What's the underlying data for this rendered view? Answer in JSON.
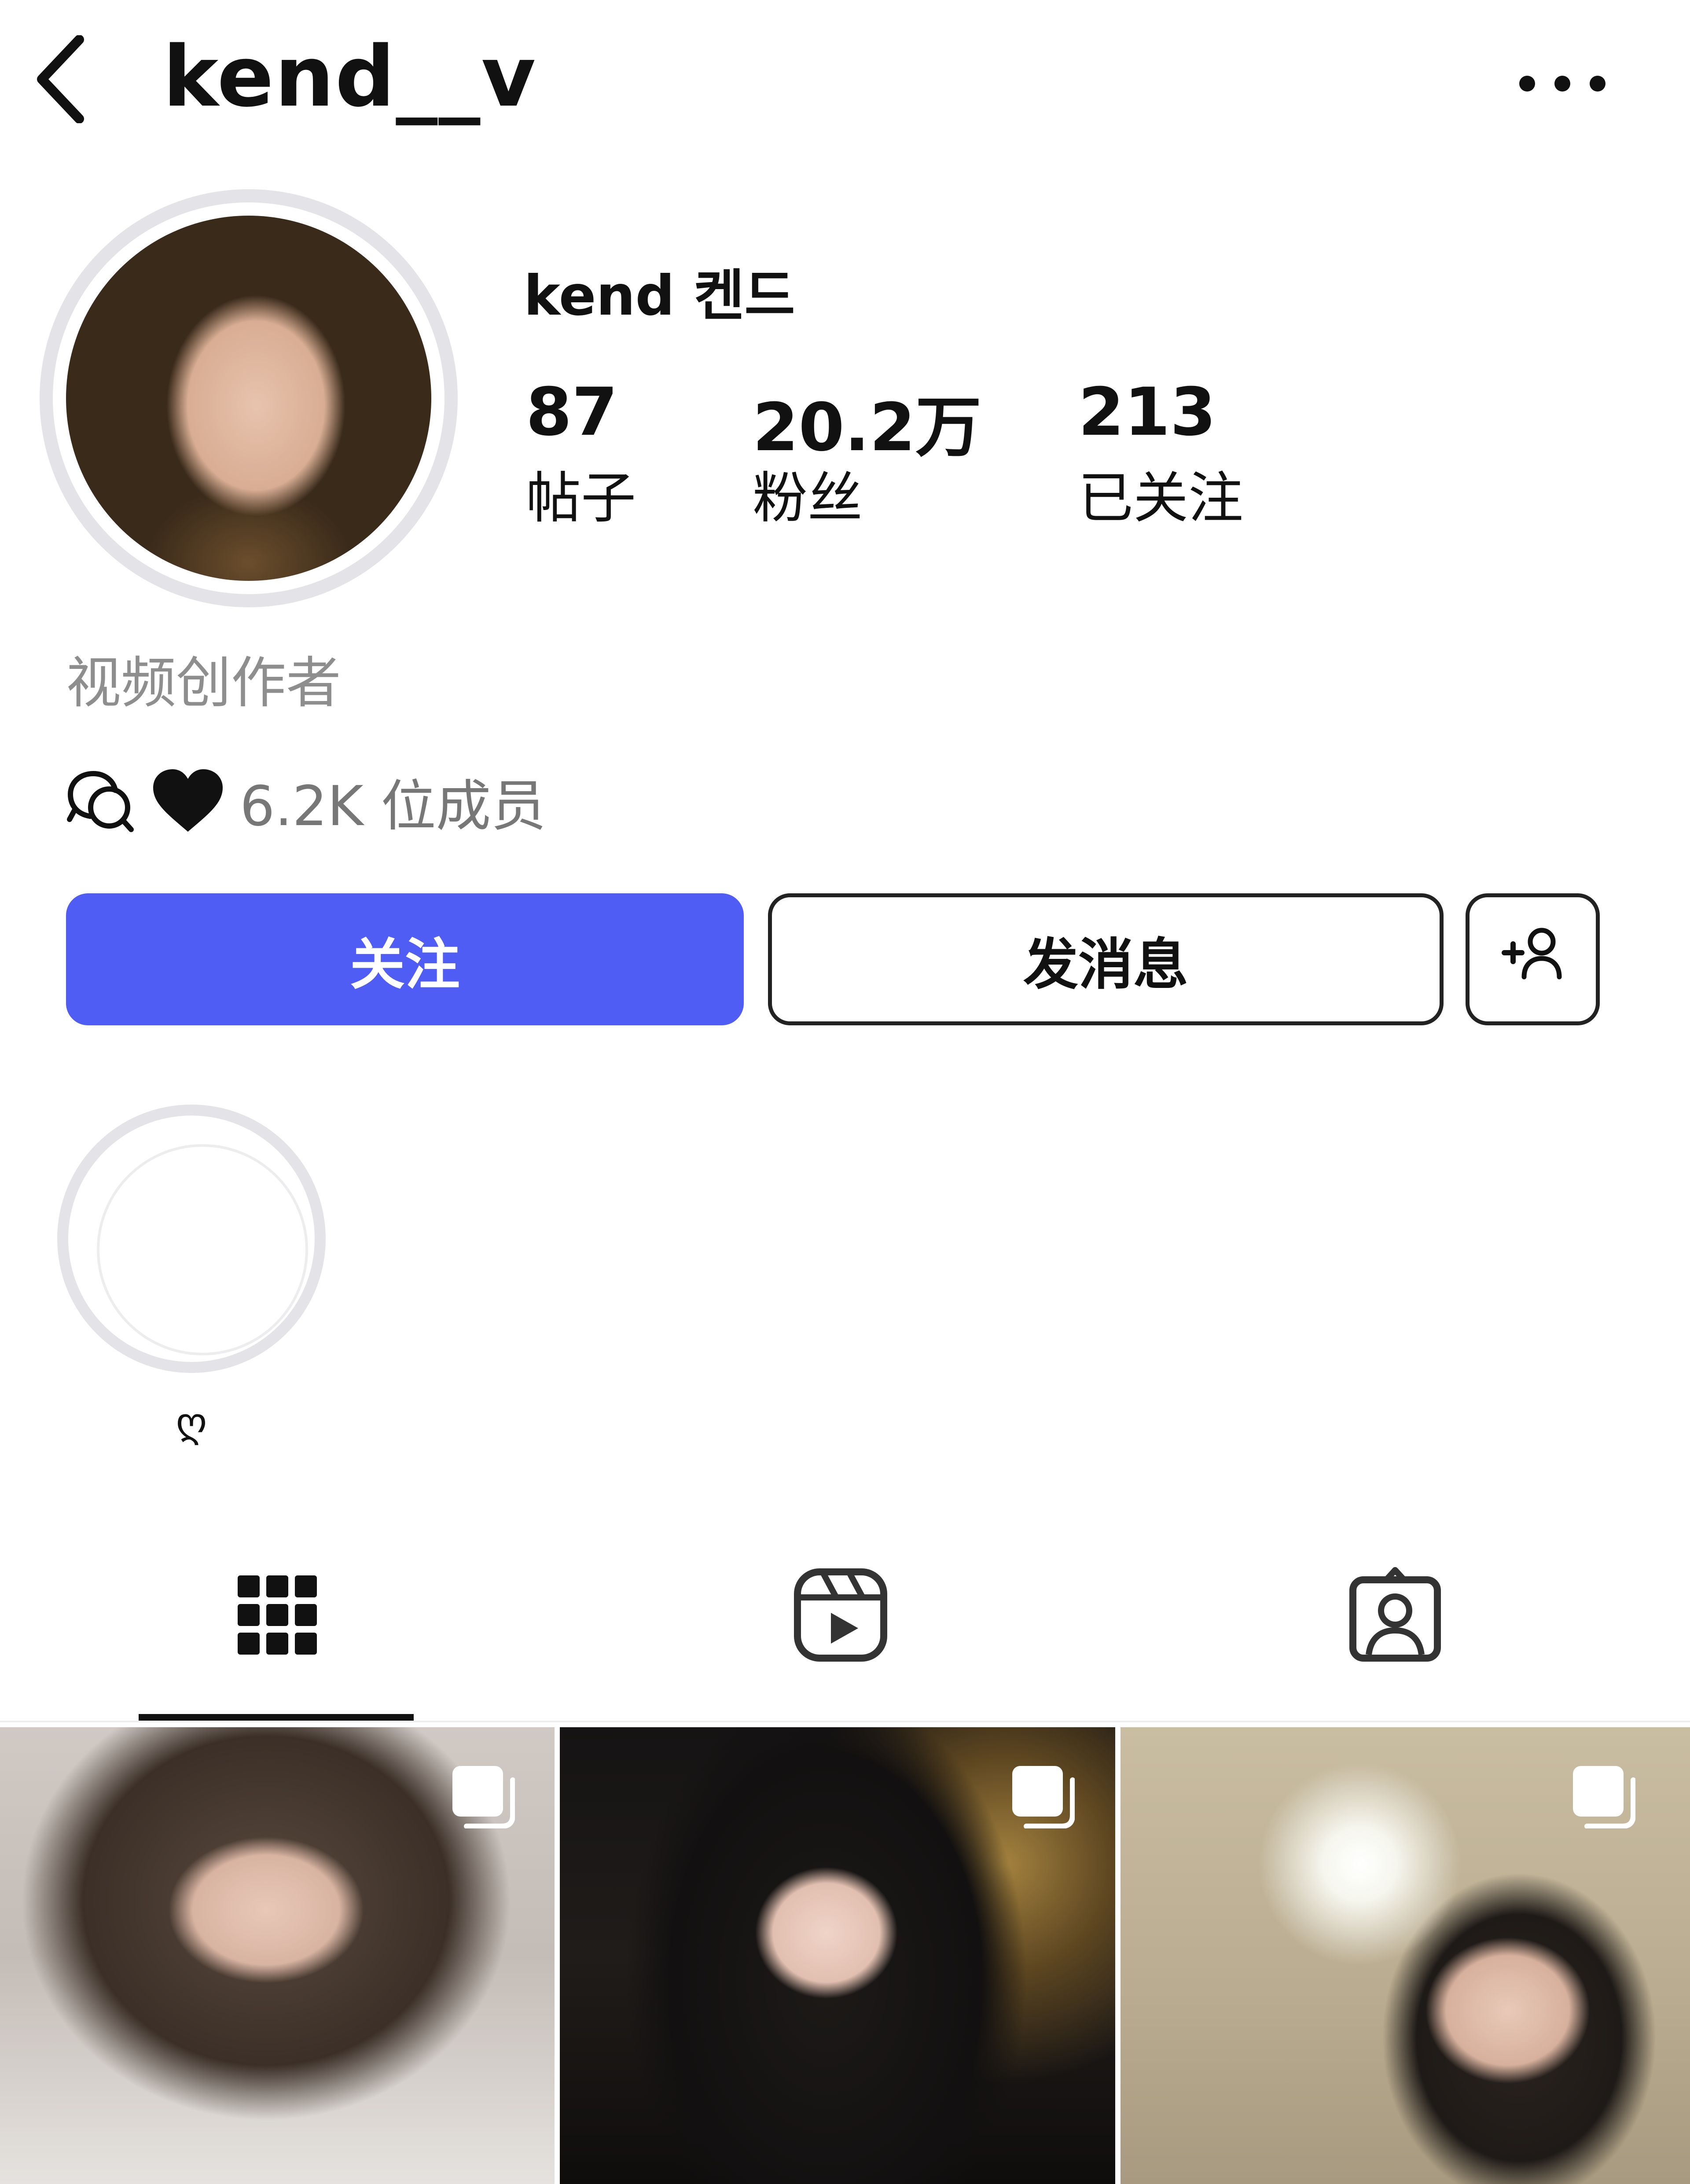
{
  "header": {
    "username": "kend__v",
    "back_icon": "chevron-left-icon",
    "more_icon": "more-horizontal-icon"
  },
  "profile": {
    "display_name": "kend 켄드",
    "bio": "视频创作者",
    "channel": {
      "icon": "broadcast-channel-icon",
      "emoji": "black-heart-icon",
      "members": "6.2K 位成员"
    },
    "stats": [
      {
        "value": "87",
        "label": "帖子"
      },
      {
        "value": "20.2万",
        "label": "粉丝"
      },
      {
        "value": "213",
        "label": "已关注"
      }
    ]
  },
  "actions": {
    "follow": "关注",
    "message": "发消息",
    "suggest_icon": "add-person-icon"
  },
  "colors": {
    "follow_button": "#4f5df5",
    "muted_text": "#8e8e8e"
  },
  "highlights": [
    {
      "label": "ღ"
    }
  ],
  "tabs": [
    {
      "icon": "grid-icon",
      "selected": true
    },
    {
      "icon": "reels-icon",
      "selected": false
    },
    {
      "icon": "tagged-icon",
      "selected": false
    }
  ],
  "posts": [
    {
      "type": "carousel",
      "icon": "multiple-photos-icon"
    },
    {
      "type": "carousel",
      "icon": "multiple-photos-icon"
    },
    {
      "type": "carousel",
      "icon": "multiple-photos-icon"
    }
  ]
}
